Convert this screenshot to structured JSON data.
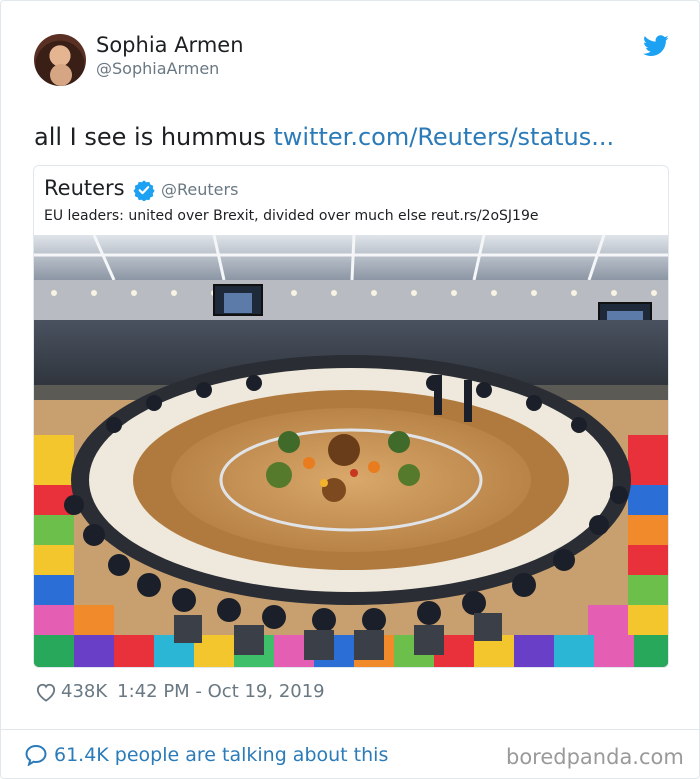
{
  "author": {
    "name": "Sophia Armen",
    "handle": "@SophiaArmen",
    "avatar_icon": "profile-photo"
  },
  "tweet": {
    "text": "all I see is hummus",
    "link_text": "twitter.com/Reuters/status..."
  },
  "quoted_tweet": {
    "name": "Reuters",
    "handle": "@Reuters",
    "verified_icon": "verified-badge-icon",
    "text": "EU leaders: united over Brexit, divided over much else reut.rs/2oSJ19e",
    "image": "photo of EU leaders seated around a round conference table with a colorful carpet and centerpiece"
  },
  "meta": {
    "likes": "438K",
    "timestamp": "1:42 PM - Oct 19, 2019"
  },
  "footer": {
    "talking": "61.4K people are talking about this",
    "watermark": "boredpanda.com"
  },
  "colors": {
    "link": "#2b7bb9",
    "twitter_blue": "#1da1f2",
    "muted": "#697882",
    "border": "#e1e8ed"
  }
}
